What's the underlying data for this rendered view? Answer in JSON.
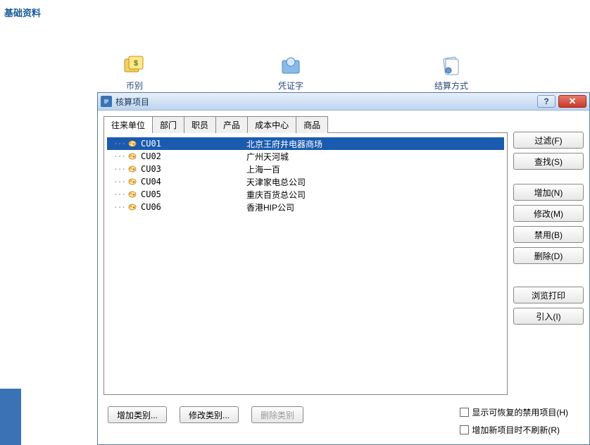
{
  "page": {
    "title": "基础资料"
  },
  "bg_icons": [
    {
      "label": "币别"
    },
    {
      "label": "凭证字"
    },
    {
      "label": "结算方式"
    }
  ],
  "dialog": {
    "title": "核算项目",
    "help": "?",
    "close": "✕",
    "tabs": [
      {
        "label": "往来单位",
        "active": true
      },
      {
        "label": "部门",
        "active": false
      },
      {
        "label": "职员",
        "active": false
      },
      {
        "label": "产品",
        "active": false
      },
      {
        "label": "成本中心",
        "active": false
      },
      {
        "label": "商品",
        "active": false
      }
    ],
    "rows": [
      {
        "code": "CU01",
        "name": "北京王府井电器商场",
        "selected": true
      },
      {
        "code": "CU02",
        "name": "广州天河城",
        "selected": false
      },
      {
        "code": "CU03",
        "name": "上海一百",
        "selected": false
      },
      {
        "code": "CU04",
        "name": "天津家电总公司",
        "selected": false
      },
      {
        "code": "CU05",
        "name": "重庆百货总公司",
        "selected": false
      },
      {
        "code": "CU06",
        "name": "香港HIP公司",
        "selected": false
      }
    ],
    "buttons": {
      "filter": "过滤(F)",
      "find": "查找(S)",
      "add": "增加(N)",
      "edit": "修改(M)",
      "disable": "禁用(B)",
      "delete": "删除(D)",
      "print": "浏览打印",
      "import": "引入(I)"
    },
    "footer": {
      "add_category": "增加类别...",
      "edit_category": "修改类别...",
      "delete_category": "删除类别",
      "check_show_disabled": "显示可恢复的禁用项目(H)",
      "check_no_refresh": "增加新项目时不刷新(R)"
    }
  }
}
